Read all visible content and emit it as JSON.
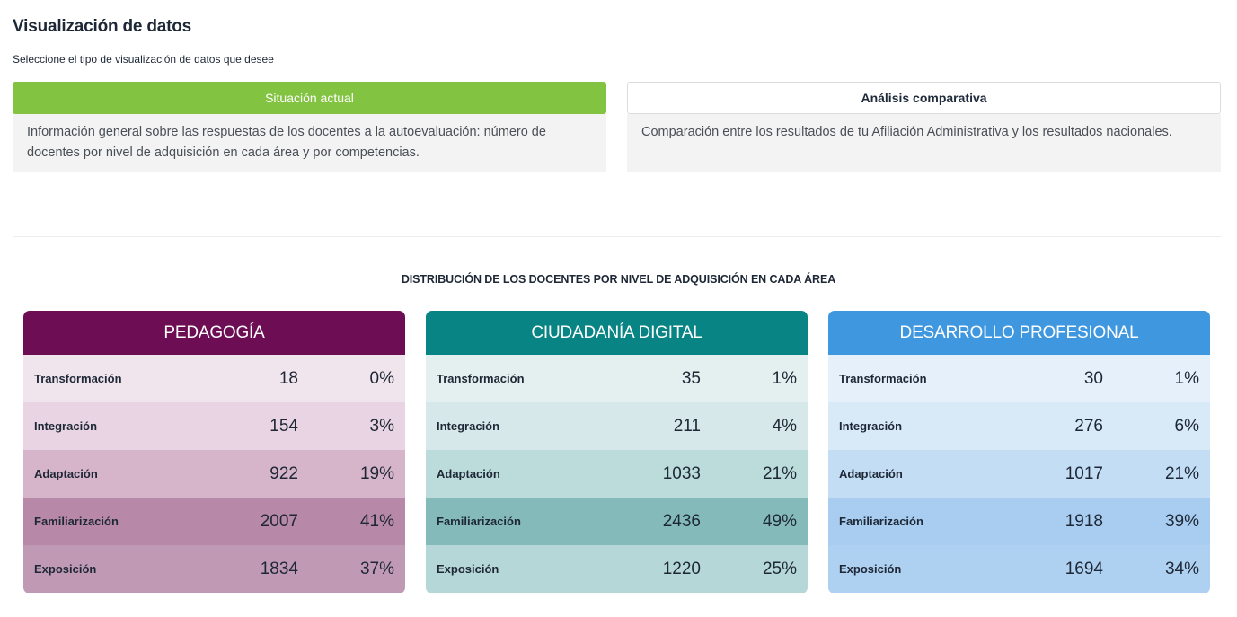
{
  "header": {
    "title": "Visualización de datos",
    "subtitle": "Seleccione el tipo de visualización de datos que desee"
  },
  "options": [
    {
      "label": "Situación actual",
      "description": "Información general sobre las respuestas de los docentes a la autoevaluación: número de docentes por nivel de adquisición en cada área y por competencias.",
      "selected": true,
      "color": "#82c341"
    },
    {
      "label": "Análisis comparativa",
      "description": "Comparación entre los resultados de tu Afiliación Administrativa y los resultados nacionales.",
      "selected": false
    }
  ],
  "section_title": "DISTRIBUCIÓN DE LOS DOCENTES POR NIVEL DE ADQUISICIÓN EN CADA ÁREA",
  "areas": [
    {
      "name": "PEDAGOGÍA",
      "header_color": "#6d0e54",
      "row_colors": [
        "#f0e4ed",
        "#e8d4e2",
        "#d6b5cb",
        "#b888a8",
        "#c09ab5"
      ],
      "rows": [
        {
          "label": "Transformación",
          "count": "18",
          "pct": "0%"
        },
        {
          "label": "Integración",
          "count": "154",
          "pct": "3%"
        },
        {
          "label": "Adaptación",
          "count": "922",
          "pct": "19%"
        },
        {
          "label": "Familiarización",
          "count": "2007",
          "pct": "41%"
        },
        {
          "label": "Exposición",
          "count": "1834",
          "pct": "37%"
        }
      ]
    },
    {
      "name": "CIUDADANÍA DIGITAL",
      "header_color": "#098484",
      "row_colors": [
        "#e4eff0",
        "#d6e8e9",
        "#bcdcdc",
        "#84baba",
        "#b5d7d7"
      ],
      "rows": [
        {
          "label": "Transformación",
          "count": "35",
          "pct": "1%"
        },
        {
          "label": "Integración",
          "count": "211",
          "pct": "4%"
        },
        {
          "label": "Adaptación",
          "count": "1033",
          "pct": "21%"
        },
        {
          "label": "Familiarización",
          "count": "2436",
          "pct": "49%"
        },
        {
          "label": "Exposición",
          "count": "1220",
          "pct": "25%"
        }
      ]
    },
    {
      "name": "DESARROLLO PROFESIONAL",
      "header_color": "#3f97e0",
      "row_colors": [
        "#e5f0fb",
        "#d8e9f8",
        "#c3ddf5",
        "#a8cdf0",
        "#aed0f1"
      ],
      "rows": [
        {
          "label": "Transformación",
          "count": "30",
          "pct": "1%"
        },
        {
          "label": "Integración",
          "count": "276",
          "pct": "6%"
        },
        {
          "label": "Adaptación",
          "count": "1017",
          "pct": "21%"
        },
        {
          "label": "Familiarización",
          "count": "1918",
          "pct": "39%"
        },
        {
          "label": "Exposición",
          "count": "1694",
          "pct": "34%"
        }
      ]
    }
  ]
}
